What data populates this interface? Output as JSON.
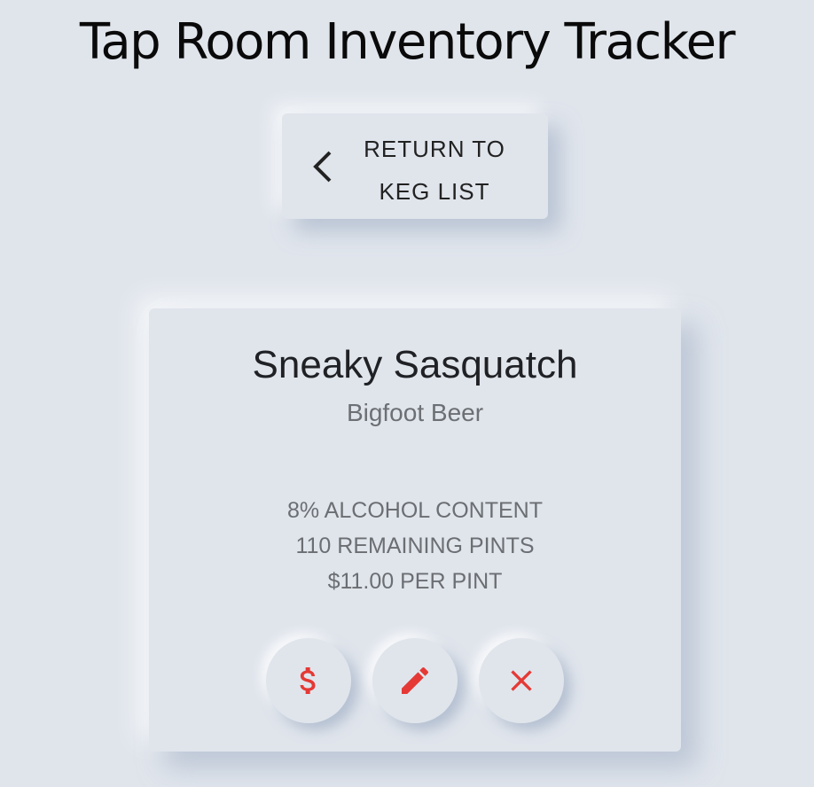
{
  "header": {
    "title": "Tap Room Inventory Tracker"
  },
  "navigation": {
    "return_label_line1": "RETURN TO",
    "return_label_line2": "KEG LIST",
    "return_icon": "chevron-left-icon"
  },
  "keg": {
    "name": "Sneaky Sasquatch",
    "brewery": "Bigfoot Beer",
    "alcohol_content": "8% ALCOHOL CONTENT",
    "remaining_pints": "110 REMAINING PINTS",
    "price_per_pint": "$11.00 PER PINT"
  },
  "actions": {
    "sell_icon": "dollar-icon",
    "edit_icon": "pencil-icon",
    "delete_icon": "close-icon"
  },
  "colors": {
    "background": "#e0e5ec",
    "accent": "#e53935",
    "title_text": "#0a0a0a",
    "muted_text": "#6b6e72"
  }
}
